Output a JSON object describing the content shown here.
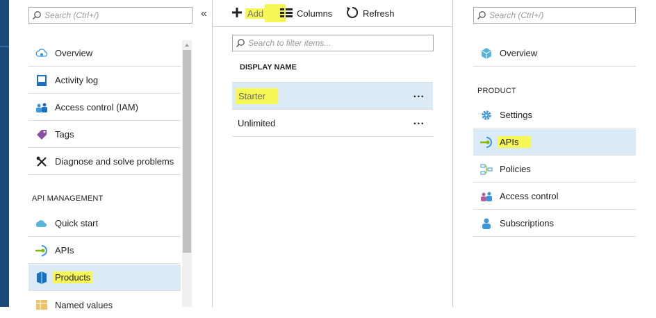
{
  "left_blade": {
    "search_placeholder": "Search (Ctrl+/)",
    "collapse": "«",
    "items": [
      {
        "label": "Overview",
        "icon": "overview-icon"
      },
      {
        "label": "Activity log",
        "icon": "activity-log-icon"
      },
      {
        "label": "Access control (IAM)",
        "icon": "access-control-icon"
      },
      {
        "label": "Tags",
        "icon": "tag-icon"
      },
      {
        "label": "Diagnose and solve problems",
        "icon": "wrench-icon"
      }
    ],
    "section_label": "API MANAGEMENT",
    "section_items": [
      {
        "label": "Quick start",
        "icon": "quick-start-icon"
      },
      {
        "label": "APIs",
        "icon": "apis-icon"
      },
      {
        "label": "Products",
        "icon": "products-icon",
        "selected": true
      },
      {
        "label": "Named values",
        "icon": "named-values-icon"
      }
    ]
  },
  "middle_blade": {
    "toolbar": {
      "add": "Add",
      "columns": "Columns",
      "refresh": "Refresh"
    },
    "filter_placeholder": "Search to filter items...",
    "column_header": "DISPLAY NAME",
    "rows": [
      {
        "name": "Starter",
        "more": "...",
        "selected": true
      },
      {
        "name": "Unlimited",
        "more": "..."
      }
    ]
  },
  "right_blade": {
    "search_placeholder": "Search (Ctrl+/)",
    "overview": "Overview",
    "section_label": "PRODUCT",
    "items": [
      {
        "label": "Settings",
        "icon": "gear-icon"
      },
      {
        "label": "APIs",
        "icon": "apis-icon",
        "selected": true
      },
      {
        "label": "Policies",
        "icon": "policies-icon"
      },
      {
        "label": "Access control",
        "icon": "access-control-icon"
      },
      {
        "label": "Subscriptions",
        "icon": "subscriptions-icon"
      }
    ]
  },
  "colors": {
    "highlight": "#f6f755",
    "selected_bg": "#dbeaf7",
    "left_bar": "#1b4a7a"
  }
}
